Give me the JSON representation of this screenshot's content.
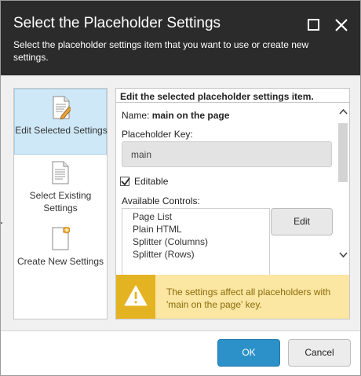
{
  "dialog": {
    "title": "Select the Placeholder Settings",
    "subtitle": "Select the placeholder settings item that you want to use or create new settings.",
    "maximize_icon": "maximize-icon",
    "close_icon": "close-icon"
  },
  "left_options": [
    {
      "label": "Edit Selected Settings",
      "icon": "document-edit-icon",
      "selected": true
    },
    {
      "label": "Select Existing Settings",
      "icon": "document-icon",
      "selected": false
    },
    {
      "label": "Create New Settings",
      "icon": "document-new-icon",
      "selected": false
    }
  ],
  "right_panel": {
    "heading": "Edit the selected placeholder settings item.",
    "name_label": "Name:",
    "name_value": "main on the page",
    "key_label": "Placeholder Key:",
    "key_value": "main",
    "editable_label": "Editable",
    "editable_checked": true,
    "controls_label": "Available Controls:",
    "controls": [
      "Page List",
      "Plain HTML",
      "Splitter (Columns)",
      "Splitter (Rows)"
    ],
    "edit_button": "Edit",
    "warning_text": "The settings affect all placeholders with 'main on the page' key."
  },
  "footer": {
    "ok_label": "OK",
    "cancel_label": "Cancel"
  },
  "colors": {
    "header_bg": "#2b2b2b",
    "selected_bg": "#cfe8f7",
    "primary_button": "#2c91c8",
    "warning_bg": "#fbe6a2",
    "warning_icon_bg": "#e4b322"
  }
}
